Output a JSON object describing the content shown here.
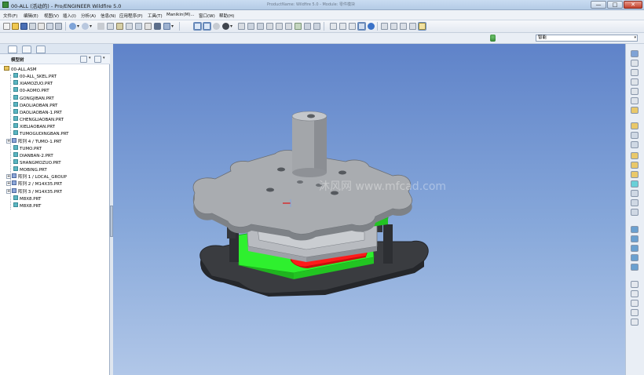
{
  "window": {
    "title": "00-ALL (活动的) - Pro/ENGINEER Wildfire 5.0",
    "center_text": "ProductName: Wildfire 5.0 - Module: 零件模块",
    "min_label": "—",
    "max_label": "□",
    "close_label": "✕"
  },
  "menu": [
    "文件(F)",
    "编辑(E)",
    "视图(V)",
    "插入(I)",
    "分析(A)",
    "信息(N)",
    "应用程序(P)",
    "工具(T)",
    "Manikin(M)...",
    "窗口(W)",
    "帮助(H)"
  ],
  "toolbar2": {
    "filter_value": "智能",
    "filter_arrow": "▾"
  },
  "model_tree": {
    "title": "模型树",
    "items": [
      {
        "label": "00-ALL.ASM",
        "type": "asm",
        "expand": ""
      },
      {
        "label": "00-ALL_SKEL.PRT",
        "type": "prt",
        "expand": ""
      },
      {
        "label": "XIAMOZUO.PRT",
        "type": "prt",
        "expand": ""
      },
      {
        "label": "00-AOMO.PRT",
        "type": "prt",
        "expand": ""
      },
      {
        "label": "GONGJIBAN.PRT",
        "type": "prt",
        "expand": ""
      },
      {
        "label": "DAOLIAOBAN.PRT",
        "type": "prt",
        "expand": ""
      },
      {
        "label": "DAOLIAOBAN-1.PRT",
        "type": "prt",
        "expand": ""
      },
      {
        "label": "CHENGLIAOBAN.PRT",
        "type": "prt",
        "expand": ""
      },
      {
        "label": "XIELIAOBAN.PRT",
        "type": "prt",
        "expand": ""
      },
      {
        "label": "TUMOGUDINGBAN.PRT",
        "type": "prt",
        "expand": ""
      },
      {
        "label": "阵列 4 / TUMO-1.PRT",
        "type": "pat",
        "expand": "+"
      },
      {
        "label": "TUMO.PRT",
        "type": "prt",
        "expand": ""
      },
      {
        "label": "DIANBAN-2.PRT",
        "type": "prt",
        "expand": ""
      },
      {
        "label": "SHANGMOZUO.PRT",
        "type": "prt",
        "expand": ""
      },
      {
        "label": "MOBING.PRT",
        "type": "prt",
        "expand": ""
      },
      {
        "label": "阵列 1 / LOCAL_GROUP",
        "type": "pat",
        "expand": "+"
      },
      {
        "label": "阵列 2 / M14X35.PRT",
        "type": "pat",
        "expand": "+"
      },
      {
        "label": "阵列 3 / M14X35.PRT",
        "type": "pat",
        "expand": "+"
      },
      {
        "label": "M8X8.PRT",
        "type": "prt",
        "expand": ""
      },
      {
        "label": "M8X8.PRT",
        "type": "prt",
        "expand": ""
      }
    ]
  },
  "watermark": "沐风网 www.mfcad.com",
  "colors": {
    "viewport_top": "#5f83c9",
    "viewport_bottom": "#b1c7e8",
    "plate_gray": "#a9acb0",
    "plate_green": "#2ef02e",
    "strip_red": "#ff1a1a",
    "base_dark": "#3a3c40"
  }
}
